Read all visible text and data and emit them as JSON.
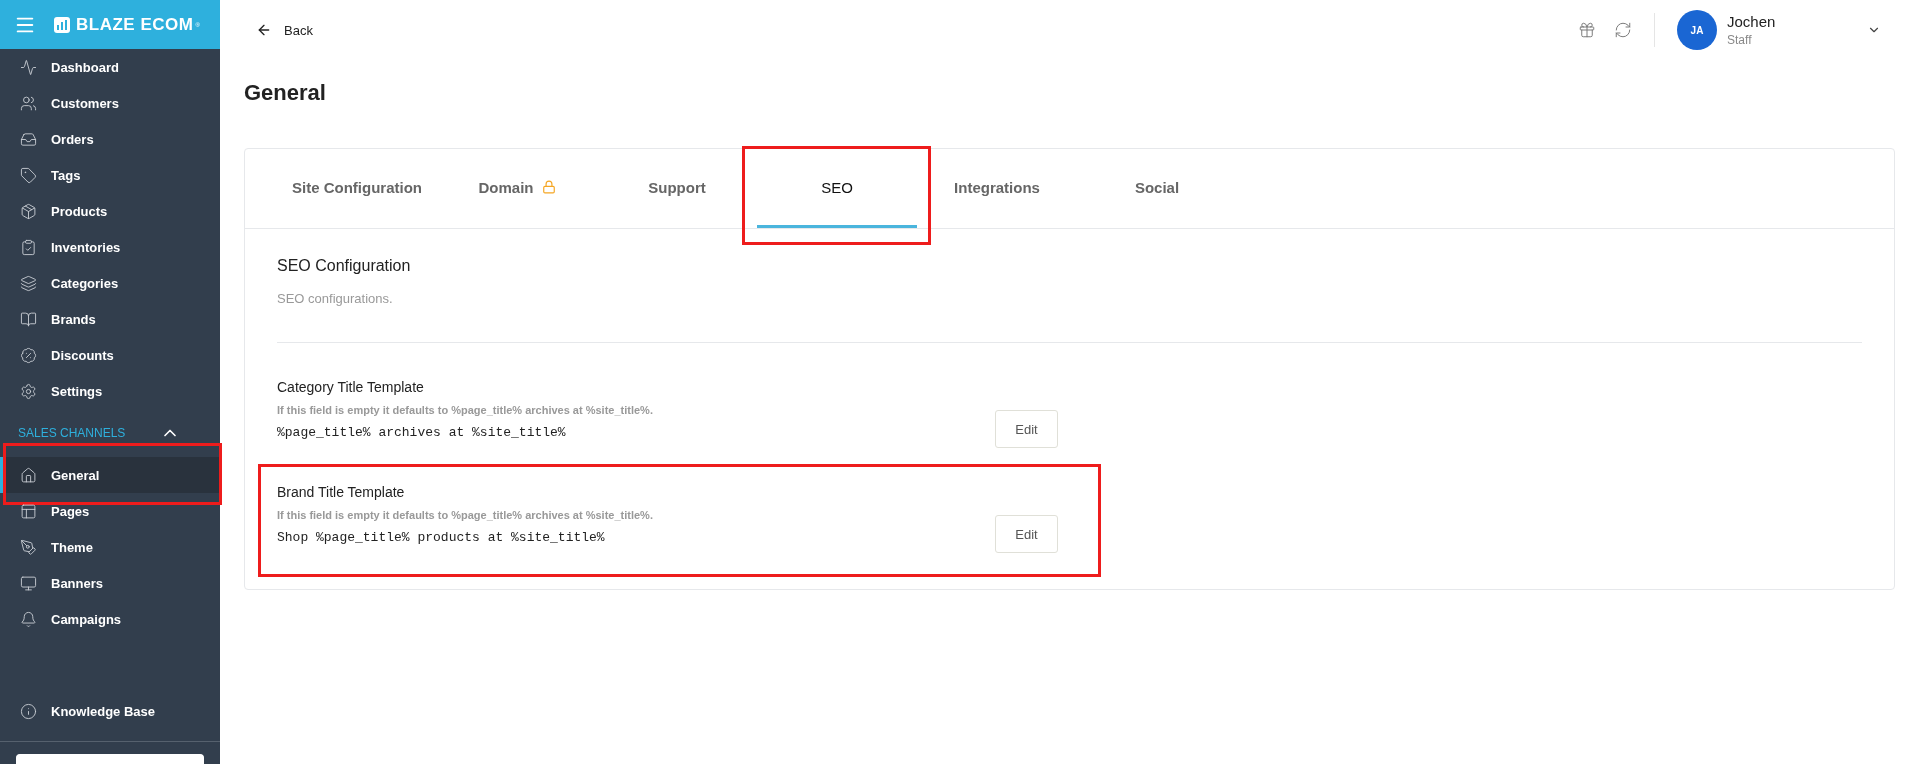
{
  "sidebar": {
    "logo": "BLAZE ECOM",
    "logo_mark": "®",
    "items": [
      {
        "label": "Dashboard",
        "selected": false
      },
      {
        "label": "Customers",
        "selected": false
      },
      {
        "label": "Orders",
        "selected": false
      },
      {
        "label": "Tags",
        "selected": false
      },
      {
        "label": "Products",
        "selected": false
      },
      {
        "label": "Inventories",
        "selected": false
      },
      {
        "label": "Categories",
        "selected": false
      },
      {
        "label": "Brands",
        "selected": false
      },
      {
        "label": "Discounts",
        "selected": false
      },
      {
        "label": "Settings",
        "selected": false
      }
    ],
    "section": {
      "title": "SALES CHANNELS",
      "expanded": true,
      "items": [
        {
          "label": "General",
          "selected": true,
          "highlighted": true
        },
        {
          "label": "Pages",
          "selected": false,
          "highlighted": false
        },
        {
          "label": "Theme",
          "selected": false,
          "highlighted": false
        },
        {
          "label": "Banners",
          "selected": false,
          "highlighted": false
        },
        {
          "label": "Campaigns",
          "selected": false,
          "highlighted": false
        }
      ]
    },
    "footer_item": "Knowledge Base"
  },
  "header": {
    "back": "Back",
    "user": {
      "initials": "JA",
      "name": "Jochen",
      "role": "Staff"
    }
  },
  "page_title": "General",
  "tabs": [
    {
      "label": "Site Configuration",
      "selected": false,
      "locked": false,
      "highlighted": false
    },
    {
      "label": "Domain",
      "selected": false,
      "locked": true,
      "highlighted": false
    },
    {
      "label": "Support",
      "selected": false,
      "locked": false,
      "highlighted": false
    },
    {
      "label": "SEO",
      "selected": true,
      "locked": false,
      "highlighted": true
    },
    {
      "label": "Integrations",
      "selected": false,
      "locked": false,
      "highlighted": false
    },
    {
      "label": "Social",
      "selected": false,
      "locked": false,
      "highlighted": false
    }
  ],
  "section": {
    "title": "SEO Configuration",
    "subtitle": "SEO configurations."
  },
  "fields": [
    {
      "label": "Category Title Template",
      "hint": "If this field is empty it defaults to %page_title% archives at %site_title%.",
      "value": "%page_title% archives at %site_title%",
      "action": "Edit",
      "highlighted": false
    },
    {
      "label": "Brand Title Template",
      "hint": "If this field is empty it defaults to %page_title% archives at %site_title%.",
      "value": "Shop %page_title% products at %site_title%",
      "action": "Edit",
      "highlighted": true
    }
  ]
}
